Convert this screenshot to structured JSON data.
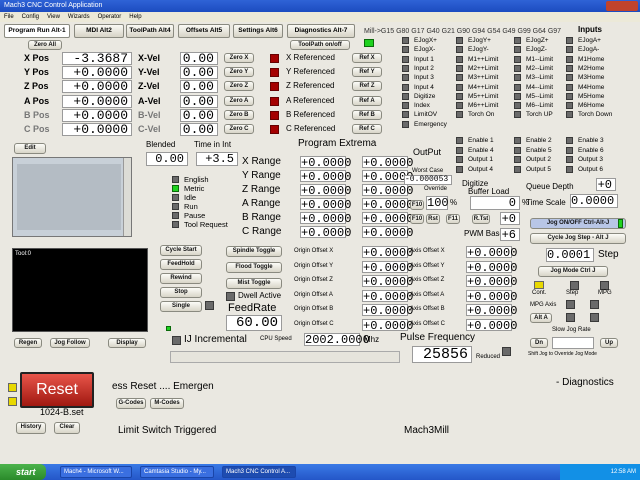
{
  "window": {
    "title": "Mach3 CNC Control Application"
  },
  "menu": [
    "File",
    "Config",
    "View",
    "Wizards",
    "Operator",
    "Help"
  ],
  "tabs": [
    "Program Run Alt-1",
    "MDI Alt2",
    "ToolPath Alt4",
    "Offsets Alt5",
    "Settings Alt6",
    "Diagnostics Alt-7"
  ],
  "header": {
    "gcodes": "Mill->G15  G80 G17 G40 G21 G90 G94 G54 G49 G99 G64 G97",
    "inputs_title": "Inputs"
  },
  "buttons": {
    "zero_all": "Zero All",
    "toolpath_onoff": "ToolPath on/off",
    "edit": "Edit",
    "regen": "Regen",
    "jog_follow": "Jog Follow",
    "display": "Display",
    "cycle_start": "Cycle Start",
    "feedhold": "FeedHold",
    "rewind": "Rewind",
    "stop": "Stop",
    "single": "Single",
    "spindle_toggle": "Spindle Toggle",
    "flood_toggle": "Flood Toggle",
    "mist_toggle": "Mist Toggle",
    "dwell_active": "Dwell Active",
    "history": "History",
    "clear": "Clear",
    "g_codes": "G-Codes",
    "m_codes": "M-Codes",
    "reset": "Reset",
    "jog_onoff": "Jog ON/OFF Ctrl-Alt-J",
    "cycle_jog_step": "Cycle Jog Step - Alt J",
    "jog_mode": "Jog Mode Ctrl J",
    "cont": "Cont.",
    "step": "Step",
    "mpg": "MPG",
    "mpg_axis": "MPG Axis",
    "alt_a": "Alt A",
    "dn": "Dn",
    "up": "Up",
    "f10": "F10",
    "rst": "Rst",
    "f11": "F11",
    "rtst": "R.Tst"
  },
  "axes": [
    {
      "name": "X Pos",
      "value": "-3.3687",
      "vel_label": "X-Vel",
      "vel": "0.00",
      "zero": "Zero X",
      "ref_label": "X Referenced",
      "ref_btn": "Ref X"
    },
    {
      "name": "Y Pos",
      "value": "+0.0000",
      "vel_label": "Y-Vel",
      "vel": "0.00",
      "zero": "Zero Y",
      "ref_label": "Y Referenced",
      "ref_btn": "Ref Y"
    },
    {
      "name": "Z Pos",
      "value": "+0.0000",
      "vel_label": "Z-Vel",
      "vel": "0.00",
      "zero": "Zero Z",
      "ref_label": "Z Referenced",
      "ref_btn": "Ref Z"
    },
    {
      "name": "A Pos",
      "value": "+0.0000",
      "vel_label": "A-Vel",
      "vel": "0.00",
      "zero": "Zero A",
      "ref_label": "A Referenced",
      "ref_btn": "Ref A"
    },
    {
      "name": "B Pos",
      "value": "+0.0000",
      "vel_label": "B-Vel",
      "vel": "0.00",
      "zero": "Zero B",
      "ref_label": "B Referenced",
      "ref_btn": "Ref B"
    },
    {
      "name": "C Pos",
      "value": "+0.0000",
      "vel_label": "C-Vel",
      "vel": "0.00",
      "zero": "Zero C",
      "ref_label": "C Referenced",
      "ref_btn": "Ref C"
    }
  ],
  "status": {
    "blended": "Blended",
    "blended_val": "0.00",
    "time_in_int": "Time in Int",
    "time_val": "+3.5",
    "modes": [
      "English",
      "Metric",
      "Idle",
      "Run",
      "Pause",
      "Tool Request"
    ]
  },
  "extrema": {
    "title": "Program Extrema",
    "rows": [
      {
        "label": "X Range",
        "min": "+0.0000",
        "max": "+0.0000"
      },
      {
        "label": "Y Range",
        "min": "+0.0000",
        "max": "+0.0000"
      },
      {
        "label": "Z Range",
        "min": "+0.0000",
        "max": "+0.0000"
      },
      {
        "label": "A Range",
        "min": "+0.0000",
        "max": "+0.0000"
      },
      {
        "label": "B Range",
        "min": "+0.0000",
        "max": "+0.0000"
      },
      {
        "label": "C Range",
        "min": "+0.0000",
        "max": "+0.0000"
      }
    ]
  },
  "inputs_mon": {
    "col1": [
      "EJogX+",
      "EJogX-",
      "Input 1",
      "Input 2",
      "Input 3",
      "Input 4",
      "Digitize",
      "Index",
      "LimitOV",
      "Emergency"
    ],
    "col2": [
      "EJogY+",
      "EJogY-",
      "M1++Limit",
      "M2++Limit",
      "M3++Limit",
      "M4++Limit",
      "M5++Limit",
      "M6++Limit",
      "Torch On"
    ],
    "col3": [
      "EJogZ+",
      "EJogZ-",
      "M1--Limit",
      "M2--Limit",
      "M3--Limit",
      "M4--Limit",
      "M5--Limit",
      "M6--Limit",
      "Torch UP"
    ],
    "col4": [
      "EJogA+",
      "EJogA-",
      "M1Home",
      "M2Home",
      "M3Home",
      "M4Home",
      "M5Home",
      "M6Home",
      "Torch Down"
    ]
  },
  "outputs": {
    "title": "OutPut",
    "col1": [
      "Enable 1",
      "Enable 4",
      "Output 1",
      "Output 4"
    ],
    "col2": [
      "Enable 2",
      "Enable 5",
      "Output 2",
      "Output 5"
    ],
    "col3": [
      "Enable 3",
      "Enable 6",
      "Output 3",
      "Output 6"
    ],
    "digitize": "Digitize",
    "buffer_load": "Buffer Load",
    "queue_depth": "Queue Depth",
    "queue_val": "+0",
    "worst_case": "Worst Case",
    "worst_val": "-0.000053",
    "override": "Override",
    "override_pct": "100",
    "pct": "%",
    "zero_pct": "0",
    "plus0": "+0",
    "pwm_base": "PWM Base",
    "pwm_val": "+6",
    "time_scale": "Time Scale",
    "time_scale_val": "0.0000"
  },
  "origins": [
    {
      "label": "Origin Offset X",
      "value": "+0.0000",
      "axis": "Axis Offset X",
      "axis_val": "+0.0000"
    },
    {
      "label": "Origin Offset Y",
      "value": "+0.0000",
      "axis": "Axis Offset Y",
      "axis_val": "+0.0000"
    },
    {
      "label": "Origin Offset Z",
      "value": "+0.0000",
      "axis": "Axis Offset Z",
      "axis_val": "+0.0000"
    },
    {
      "label": "Origin Offset A",
      "value": "+0.0000",
      "axis": "Axis Offset A",
      "axis_val": "+0.0000"
    },
    {
      "label": "Origin Offset B",
      "value": "+0.0000",
      "axis": "Axis Offset B",
      "axis_val": "+0.0000"
    },
    {
      "label": "Origin Offset C",
      "value": "+0.0000",
      "axis": "Axis Offset C",
      "axis_val": "+0.0000"
    }
  ],
  "feed": {
    "label": "FeedRate",
    "value": "60.00"
  },
  "ij": {
    "label": "IJ Incremental",
    "cpu_label": "CPU Speed",
    "cpu_val": "2002.0000",
    "mhz": "Mhz"
  },
  "pulse": {
    "label": "Pulse Frequency",
    "value": "25856",
    "reduced": "Reduced"
  },
  "jog": {
    "step_val": "0.0001",
    "step_label": "Step",
    "slow_jog": "Slow Jog Rate",
    "shift_jog": "Shift Jog to Override Jog Mode"
  },
  "toolpath": {
    "tool_label": "Tool:0"
  },
  "errors": {
    "line": "ess Reset .... Emergen",
    "profile": "1024-B.set",
    "limit": "Limit Switch Triggered",
    "product": "Mach3Mill",
    "diagnostics": "- Diagnostics"
  },
  "taskbar": {
    "start": "start",
    "items": [
      "Mach4 - Microsoft W...",
      "Camtasia Studio - My...",
      "Mach3 CNC Control A..."
    ],
    "clock": "12:58 AM"
  }
}
